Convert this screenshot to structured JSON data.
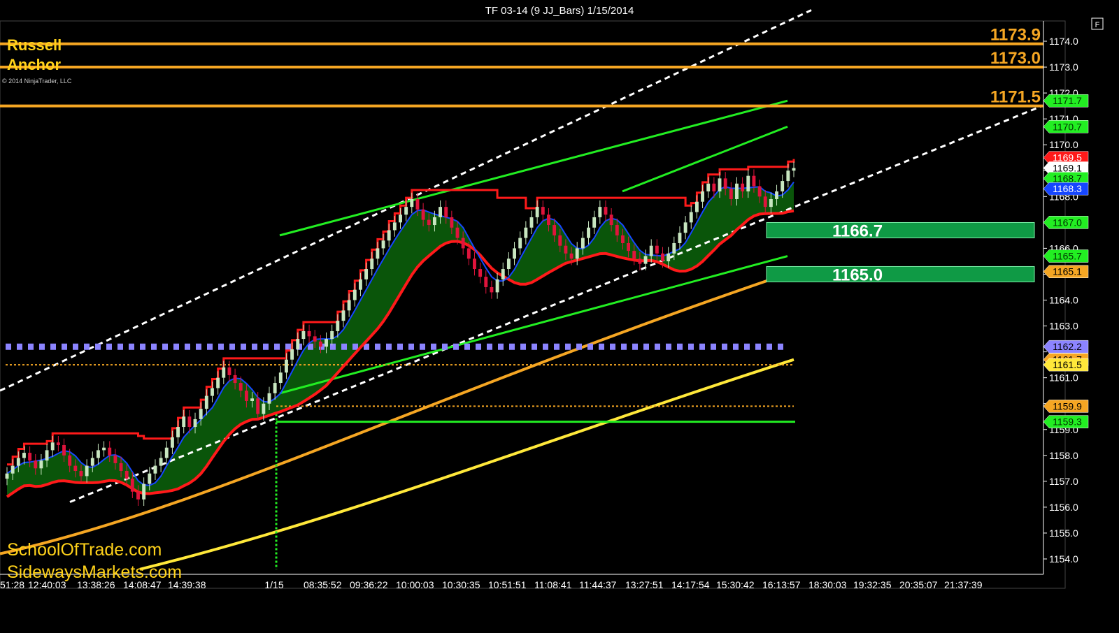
{
  "window": {
    "title": "TF 03-14 (9 JJ_Bars)  1/15/2014",
    "corner_button": "F",
    "copyright": "© 2014 NinjaTrader, LLC"
  },
  "branding": {
    "top_label_line1": "Russell",
    "top_label_line2": "Anchor",
    "site1": "SchoolOfTrade.com",
    "site2": "SidewaysMarkets.com"
  },
  "colors": {
    "background": "#000000",
    "bull_candle": "#c8e6c0",
    "bear_candle": "#e0143c",
    "flat_candle": "#ff33ff",
    "ema_fill": "#0b5e0b",
    "red_line": "#ff1a1a",
    "blue_line": "#1646ff",
    "orange": "#f5a623",
    "yellow": "#ffe83a",
    "green": "#22ee22",
    "dotted_blue": "#8c84ff"
  },
  "chart_data": {
    "type": "candlestick",
    "title": "TF 03-14 (9 JJ_Bars)  1/15/2014",
    "ylim": [
      1153.6,
      1175.0
    ],
    "y_ticks": [
      "1154.0",
      "1155.0",
      "1156.0",
      "1157.0",
      "1158.0",
      "1159.0",
      "1160.0",
      "1161.0",
      "1162.0",
      "1163.0",
      "1164.0",
      "1165.0",
      "1166.0",
      "1167.0",
      "1168.0",
      "1169.0",
      "1170.0",
      "1171.0",
      "1172.0",
      "1173.0",
      "1174.0"
    ],
    "x_tick_labels": [
      "51:28",
      "12:40:03",
      "13:38:26",
      "14:08:47",
      "14:39:38",
      "1/15",
      "08:35:52",
      "09:36:22",
      "10:00:03",
      "10:30:35",
      "10:51:51",
      "11:08:41",
      "11:44:37",
      "13:27:51",
      "14:17:54",
      "15:30:42",
      "16:13:57",
      "18:30:03",
      "19:32:35",
      "20:35:07",
      "21:37:39"
    ],
    "closes": [
      1157.3,
      1157.6,
      1157.9,
      1158.1,
      1157.8,
      1157.5,
      1157.8,
      1158.2,
      1158.5,
      1158.4,
      1158.0,
      1157.6,
      1157.4,
      1157.2,
      1157.6,
      1157.9,
      1158.2,
      1158.3,
      1158.0,
      1157.7,
      1157.4,
      1157.1,
      1156.6,
      1156.3,
      1156.9,
      1157.3,
      1157.6,
      1157.9,
      1158.3,
      1158.7,
      1159.1,
      1159.5,
      1159.1,
      1159.4,
      1159.8,
      1160.3,
      1160.6,
      1161.0,
      1161.4,
      1161.1,
      1160.8,
      1160.5,
      1160.1,
      1160.2,
      1159.6,
      1160.0,
      1160.4,
      1160.8,
      1161.2,
      1161.7,
      1162.1,
      1162.5,
      1162.8,
      1162.6,
      1162.4,
      1162.2,
      1162.5,
      1162.8,
      1163.2,
      1163.6,
      1164.0,
      1164.4,
      1164.8,
      1165.2,
      1165.6,
      1166.0,
      1166.3,
      1166.7,
      1167.0,
      1167.3,
      1167.6,
      1167.9,
      1167.5,
      1167.1,
      1166.9,
      1167.2,
      1167.6,
      1167.2,
      1166.8,
      1166.4,
      1166.0,
      1165.6,
      1165.2,
      1164.9,
      1164.5,
      1164.3,
      1164.8,
      1165.2,
      1165.6,
      1166.0,
      1166.4,
      1166.8,
      1167.2,
      1167.6,
      1167.3,
      1166.9,
      1166.5,
      1166.1,
      1165.8,
      1165.6,
      1166.0,
      1166.4,
      1166.8,
      1167.2,
      1167.6,
      1167.3,
      1166.9,
      1166.5,
      1166.2,
      1165.9,
      1165.6,
      1165.4,
      1165.7,
      1166.1,
      1165.8,
      1165.5,
      1165.8,
      1166.2,
      1166.6,
      1167.0,
      1167.4,
      1167.8,
      1168.2,
      1168.5,
      1168.2,
      1168.7,
      1168.3,
      1167.9,
      1168.5,
      1168.2,
      1168.8,
      1168.4,
      1168.0,
      1167.6,
      1167.9,
      1168.2,
      1168.6,
      1169.0,
      1169.1
    ],
    "levels": [
      {
        "label": "1173.9",
        "value": 1173.9,
        "color": "#f5a623",
        "style": "solid"
      },
      {
        "label": "1173.0",
        "value": 1173.0,
        "color": "#f5a623",
        "style": "solid"
      },
      {
        "label": "1171.5",
        "value": 1171.5,
        "color": "#f5a623",
        "style": "solid"
      },
      {
        "value": 1162.2,
        "color": "#8c84ff",
        "style": "dotted-thick"
      },
      {
        "value": 1161.5,
        "color": "#f5a623",
        "style": "dotted"
      },
      {
        "value": 1159.9,
        "color": "#f5a623",
        "style": "dotted"
      },
      {
        "value": 1159.3,
        "color": "#22ee22",
        "style": "solid"
      }
    ],
    "zones": [
      {
        "label": "1166.7",
        "value": 1166.7
      },
      {
        "label": "1165.0",
        "value": 1165.0
      }
    ],
    "price_tags": [
      {
        "label": "1171.7",
        "value": 1171.7,
        "bg": "#22ee22",
        "fg": "#003300"
      },
      {
        "label": "1170.7",
        "value": 1170.7,
        "bg": "#22ee22",
        "fg": "#003300"
      },
      {
        "label": "1169.5",
        "value": 1169.5,
        "bg": "#ff1a1a",
        "fg": "#ffffff"
      },
      {
        "label": "1169.1",
        "value": 1169.1,
        "bg": "#ffffff",
        "fg": "#000000"
      },
      {
        "label": "1168.7",
        "value": 1168.7,
        "bg": "#22ee22",
        "fg": "#003300"
      },
      {
        "label": "1168.3",
        "value": 1168.3,
        "bg": "#1646ff",
        "fg": "#ffffff"
      },
      {
        "label": "1167.0",
        "value": 1167.0,
        "bg": "#22ee22",
        "fg": "#003300"
      },
      {
        "label": "1165.7",
        "value": 1165.7,
        "bg": "#22ee22",
        "fg": "#003300"
      },
      {
        "label": "1165.1",
        "value": 1165.1,
        "bg": "#f5a623",
        "fg": "#000000"
      },
      {
        "label": "1162.2",
        "value": 1162.2,
        "bg": "#8c84ff",
        "fg": "#000000"
      },
      {
        "label": "1161.7",
        "value": 1161.7,
        "bg": "#f5a623",
        "fg": "#000000"
      },
      {
        "label": "1161.5",
        "value": 1161.5,
        "bg": "#ffe83a",
        "fg": "#000000"
      },
      {
        "label": "1159.9",
        "value": 1159.9,
        "bg": "#f5a623",
        "fg": "#000000"
      },
      {
        "label": "1159.3",
        "value": 1159.3,
        "bg": "#22ee22",
        "fg": "#003300"
      }
    ]
  }
}
